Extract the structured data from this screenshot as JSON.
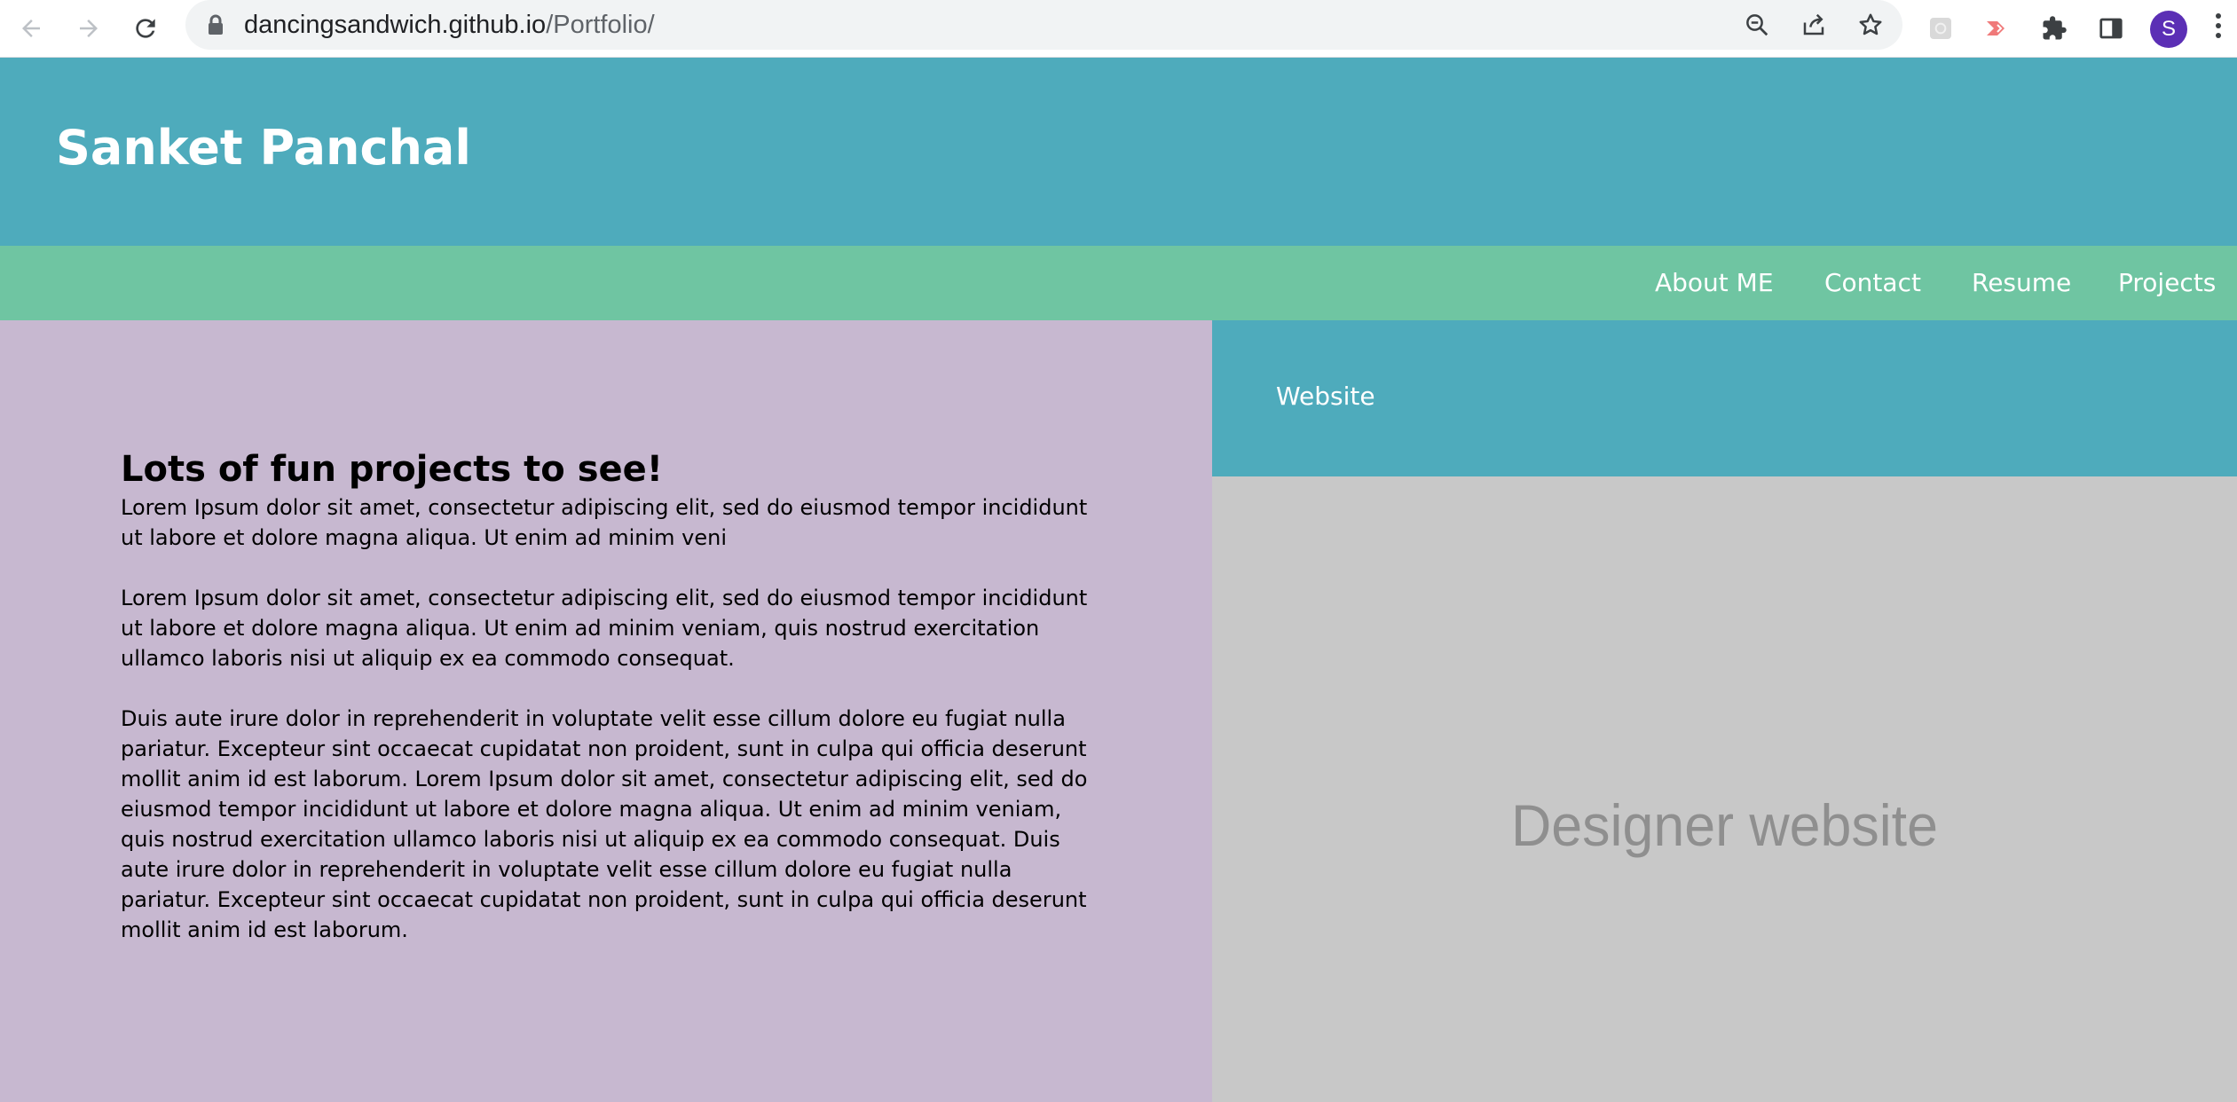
{
  "browser": {
    "url_domain": "dancingsandwich.github.io",
    "url_path": "/Portfolio/",
    "profile_initial": "S",
    "icons": [
      "back-icon",
      "forward-icon",
      "reload-icon",
      "lock-icon",
      "zoom-icon",
      "share-icon",
      "bookmark-star-icon",
      "extension-grid-icon",
      "extension-arrow-icon",
      "puzzle-icon",
      "side-panel-icon",
      "menu-kebab-icon"
    ]
  },
  "header": {
    "title": "Sanket Panchal"
  },
  "nav": {
    "items": [
      "About ME",
      "Contact",
      "Resume",
      "Projects"
    ]
  },
  "intro": {
    "heading": "Lots of fun projects to see!",
    "paragraphs": [
      "Lorem Ipsum dolor sit amet, consectetur adipiscing elit, sed do eiusmod tempor incididunt ut labore et dolore magna aliqua. Ut enim ad minim veni",
      "Lorem Ipsum dolor sit amet, consectetur adipiscing elit, sed do eiusmod tempor incididunt ut labore et dolore magna aliqua. Ut enim ad minim veniam, quis nostrud exercitation ullamco laboris nisi ut aliquip ex ea commodo consequat.",
      "Duis aute irure dolor in reprehenderit in voluptate velit esse cillum dolore eu fugiat nulla pariatur. Excepteur sint occaecat cupidatat non proident, sunt in culpa qui officia deserunt mollit anim id est laborum. Lorem Ipsum dolor sit amet, consectetur adipiscing elit, sed do eiusmod tempor incididunt ut labore et dolore magna aliqua. Ut enim ad minim veniam, quis nostrud exercitation ullamco laboris nisi ut aliquip ex ea commodo consequat. Duis aute irure dolor in reprehenderit in voluptate velit esse cillum dolore eu fugiat nulla pariatur. Excepteur sint occaecat cupidatat non proident, sunt in culpa qui officia deserunt mollit anim id est laborum."
    ]
  },
  "project": {
    "label": "Website",
    "preview_text": "Designer website"
  },
  "colors": {
    "header_bg": "#4eabbc",
    "nav_bg": "#6fc5a2",
    "intro_bg": "#c7b8d0",
    "preview_bg": "#c8c8c8",
    "avatar_bg": "#5b2fb5"
  }
}
